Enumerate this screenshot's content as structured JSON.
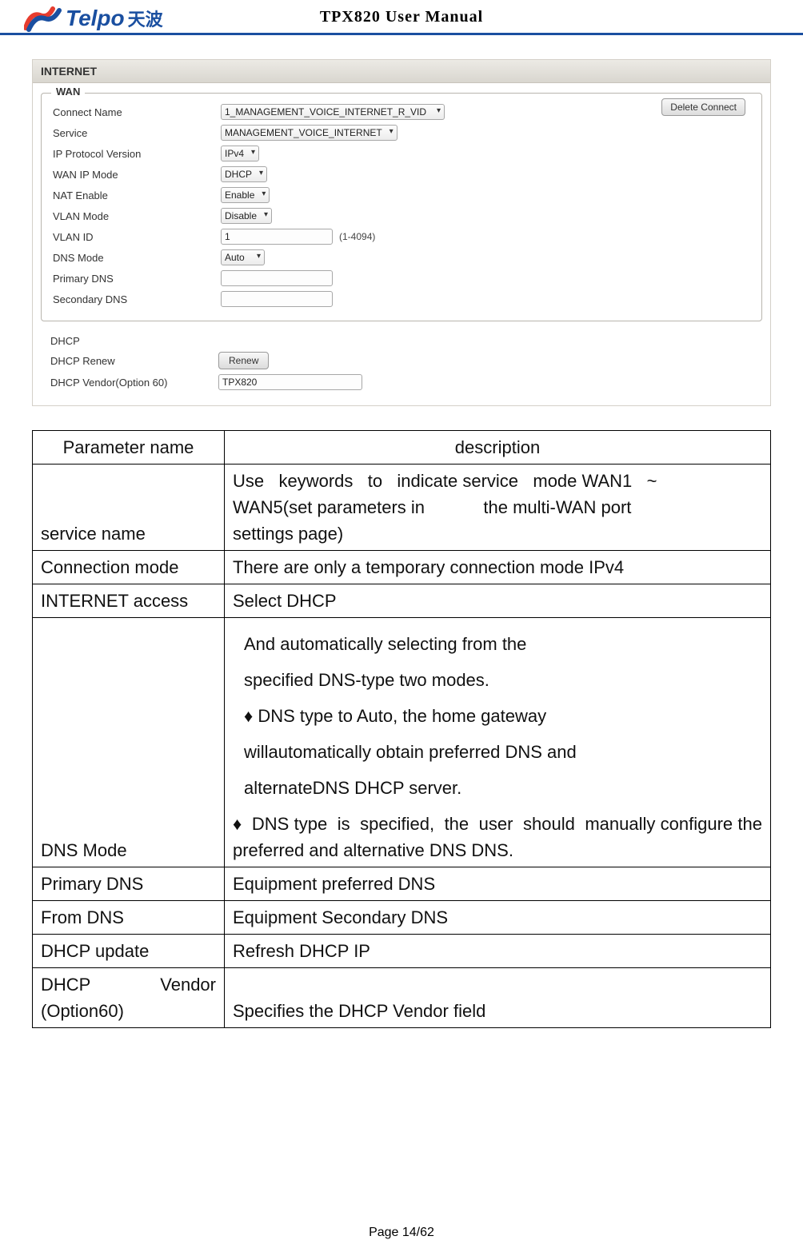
{
  "header": {
    "logo_en": "Telpo",
    "logo_cn": "天波",
    "doc_title": "TPX820 User Manual"
  },
  "screenshot": {
    "banner": "INTERNET",
    "legend": "WAN",
    "delete_btn": "Delete Connect",
    "rows": {
      "connect_name": {
        "label": "Connect Name",
        "value": "1_MANAGEMENT_VOICE_INTERNET_R_VID"
      },
      "service": {
        "label": "Service",
        "value": "MANAGEMENT_VOICE_INTERNET"
      },
      "ip_proto": {
        "label": "IP Protocol Version",
        "value": "IPv4"
      },
      "wan_ip_mode": {
        "label": "WAN IP Mode",
        "value": "DHCP"
      },
      "nat_enable": {
        "label": "NAT Enable",
        "value": "Enable"
      },
      "vlan_mode": {
        "label": "VLAN Mode",
        "value": "Disable"
      },
      "vlan_id": {
        "label": "VLAN ID",
        "value": "1",
        "hint": "(1-4094)"
      },
      "dns_mode": {
        "label": "DNS Mode",
        "value": "Auto"
      },
      "primary_dns": {
        "label": "Primary DNS",
        "value": ""
      },
      "secondary_dns": {
        "label": "Secondary DNS",
        "value": ""
      }
    },
    "dhcp": {
      "heading": "DHCP",
      "renew_label": "DHCP Renew",
      "renew_btn": "Renew",
      "vendor_label": "DHCP Vendor(Option 60)",
      "vendor_value": "TPX820"
    }
  },
  "table": {
    "header": {
      "col1": "Parameter name",
      "col2": "description"
    },
    "service_name": {
      "name": "service name",
      "desc_line1": "Use   keywords   to   indicate service   mode WAN1   ~",
      "desc_line2": "WAN5(set parameters in            the multi-WAN port",
      "desc_line3": "settings page)"
    },
    "connection_mode": {
      "name": "Connection mode",
      "desc": "There are only a temporary connection mode IPv4"
    },
    "internet_access": {
      "name": "INTERNET access",
      "desc": "Select DHCP"
    },
    "dns_mode": {
      "name": "DNS Mode",
      "p1": "And automatically selecting from the",
      "p2": "specified DNS-type two modes.",
      "p3": "♦ DNS type to Auto, the home gateway",
      "p4": " willautomatically obtain preferred DNS and",
      "p5": " alternateDNS DHCP server.",
      "p6": "♦  DNS type  is  specified,  the  user  should  manually configure the preferred and alternative DNS DNS."
    },
    "primary_dns": {
      "name": "Primary DNS",
      "desc": "Equipment preferred DNS"
    },
    "from_dns": {
      "name": "From DNS",
      "desc": "Equipment Secondary DNS"
    },
    "dhcp_update": {
      "name": "DHCP update",
      "desc": "Refresh DHCP IP"
    },
    "dhcp_vendor": {
      "name_l1": "DHCP",
      "name_l2": "Vendor",
      "name_l3": "(Option60)",
      "desc": "Specifies the DHCP Vendor field"
    }
  },
  "footer": {
    "page": "Page 14/62"
  }
}
